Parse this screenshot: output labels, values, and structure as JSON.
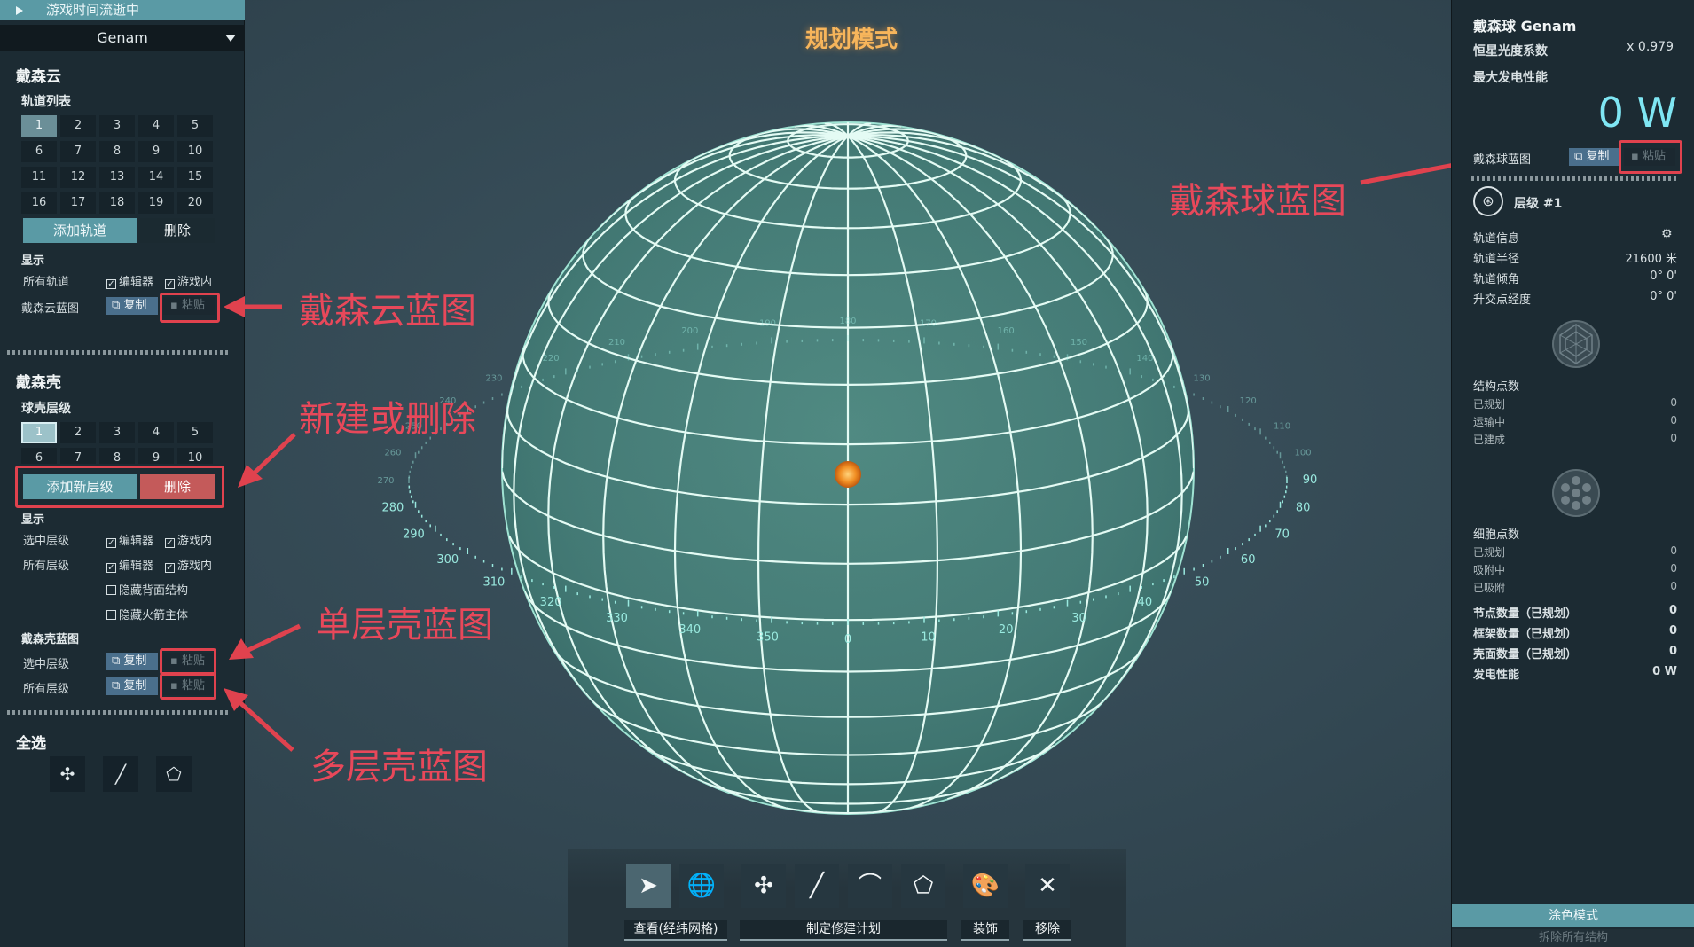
{
  "left": {
    "time_status": "游戏时间流逝中",
    "star_name": "Genam",
    "swarm": {
      "title": "戴森云",
      "orbit_list_label": "轨道列表",
      "orbits": [
        "1",
        "2",
        "3",
        "4",
        "5",
        "6",
        "7",
        "8",
        "9",
        "10",
        "11",
        "12",
        "13",
        "14",
        "15",
        "16",
        "17",
        "18",
        "19",
        "20"
      ],
      "add_orbit": "添加轨道",
      "delete": "删除",
      "display_label": "显示",
      "all_orbits": "所有轨道",
      "editor": "编辑器",
      "in_game": "游戏内",
      "blueprint_label": "戴森云蓝图",
      "copy": "复制",
      "paste": "粘贴"
    },
    "shell": {
      "title": "戴森壳",
      "layer_label": "球壳层级",
      "layers": [
        "1",
        "2",
        "3",
        "4",
        "5",
        "6",
        "7",
        "8",
        "9",
        "10"
      ],
      "add_layer": "添加新层级",
      "delete": "删除",
      "display_label": "显示",
      "selected_layer": "选中层级",
      "all_layers": "所有层级",
      "editor": "编辑器",
      "in_game": "游戏内",
      "hide_back": "隐藏背面结构",
      "hide_rocket": "隐藏火箭主体",
      "blueprint_title": "戴森壳蓝图",
      "bp_selected": "选中层级",
      "bp_all": "所有层级",
      "copy": "复制",
      "paste": "粘贴"
    },
    "select_all": "全选"
  },
  "center": {
    "mode_title": "规划模式",
    "ring_ticks": [
      "0",
      "10",
      "20",
      "30",
      "40",
      "50",
      "60",
      "70",
      "80",
      "90",
      "100",
      "110",
      "120",
      "130",
      "140",
      "150",
      "160",
      "170",
      "180",
      "190",
      "200",
      "210",
      "220",
      "230",
      "240",
      "250",
      "260",
      "270",
      "280",
      "290",
      "300",
      "310",
      "320",
      "330",
      "340",
      "350"
    ]
  },
  "toolbar": {
    "view_label": "查看(经纬网格)",
    "plan_label": "制定修建计划",
    "decorate_label": "装饰",
    "remove_label": "移除"
  },
  "right": {
    "sphere_name": "戴森球 Genam",
    "luminosity_label": "恒星光度系数",
    "luminosity_value": "x 0.979",
    "max_power_label": "最大发电性能",
    "power_value": "0 W",
    "blueprint_label": "戴森球蓝图",
    "copy": "复制",
    "paste": "粘贴",
    "layer_label": "层级 #1",
    "orbit_info": "轨道信息",
    "orbit_radius_label": "轨道半径",
    "orbit_radius_value": "21600 米",
    "orbit_incl_label": "轨道倾角",
    "orbit_incl_value": "0° 0'",
    "node_long_label": "升交点经度",
    "node_long_value": "0° 0'",
    "struct_points": "结构点数",
    "planned": "已规划",
    "in_transit": "运输中",
    "built": "已建成",
    "cell_points": "细胞点数",
    "absorbing": "吸附中",
    "absorbed": "已吸附",
    "zero": "0",
    "node_count": "节点数量（已规划）",
    "frame_count": "框架数量（已规划）",
    "shell_count": "壳面数量（已规划）",
    "gen_perf": "发电性能",
    "gen_perf_value": "0 W",
    "paint_mode": "涂色模式",
    "dismantle_all": "拆除所有结构"
  },
  "callouts": {
    "swarm_bp": "戴森云蓝图",
    "new_or_delete": "新建或删除",
    "single_layer_bp": "单层壳蓝图",
    "multi_layer_bp": "多层壳蓝图",
    "sphere_bp": "戴森球蓝图"
  },
  "colors": {
    "accent": "#5a9aa5",
    "danger": "#c45a5a",
    "annotation": "#e0424e",
    "grid_line": "#d8f5ec",
    "sphere_fill": "#5fb59e",
    "mode_title": "#f7b55b"
  }
}
